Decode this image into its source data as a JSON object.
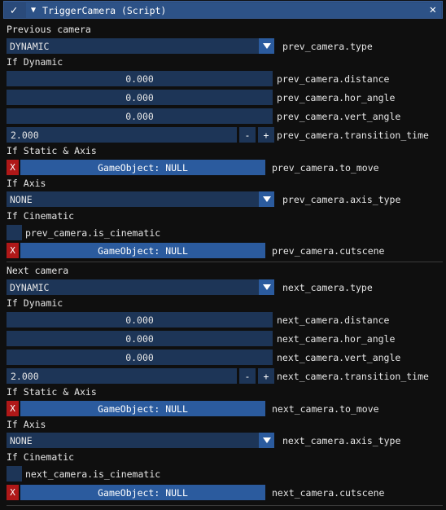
{
  "component": {
    "title": "TriggerCamera (Script)",
    "enabled_icon": "check-icon",
    "collapse_icon": "triangle-down-icon",
    "close_icon": "close-icon"
  },
  "prev": {
    "section_title": "Previous camera",
    "type_value": "DYNAMIC",
    "type_label": "prev_camera.type",
    "if_dynamic": "If Dynamic",
    "distance_value": "0.000",
    "distance_label": "prev_camera.distance",
    "hor_angle_value": "0.000",
    "hor_angle_label": "prev_camera.hor_angle",
    "vert_angle_value": "0.000",
    "vert_angle_label": "prev_camera.vert_angle",
    "transition_value": "2.000",
    "transition_label": "prev_camera.transition_time",
    "minus": "-",
    "plus": "+",
    "if_static_axis": "If Static & Axis",
    "to_move_value": "GameObject: NULL",
    "to_move_label": "prev_camera.to_move",
    "if_axis": "If Axis",
    "axis_type_value": "NONE",
    "axis_type_label": "prev_camera.axis_type",
    "if_cinematic": "If Cinematic",
    "is_cinematic_label": "prev_camera.is_cinematic",
    "cutscene_value": "GameObject: NULL",
    "cutscene_label": "prev_camera.cutscene",
    "x": "X"
  },
  "next": {
    "section_title": "Next camera",
    "type_value": "DYNAMIC",
    "type_label": "next_camera.type",
    "if_dynamic": "If Dynamic",
    "distance_value": "0.000",
    "distance_label": "next_camera.distance",
    "hor_angle_value": "0.000",
    "hor_angle_label": "next_camera.hor_angle",
    "vert_angle_value": "0.000",
    "vert_angle_label": "next_camera.vert_angle",
    "transition_value": "2.000",
    "transition_label": "next_camera.transition_time",
    "minus": "-",
    "plus": "+",
    "if_static_axis": "If Static & Axis",
    "to_move_value": "GameObject: NULL",
    "to_move_label": "next_camera.to_move",
    "if_axis": "If Axis",
    "axis_type_value": "NONE",
    "axis_type_label": "next_camera.axis_type",
    "if_cinematic": "If Cinematic",
    "is_cinematic_label": "next_camera.is_cinematic",
    "cutscene_value": "GameObject: NULL",
    "cutscene_label": "next_camera.cutscene",
    "x": "X"
  },
  "colors": {
    "header_bg": "#2d5287",
    "field_bg": "#1d3557",
    "button_bg": "#2b5b9e",
    "remove_red": "#b01818",
    "panel_bg": "#0f0f0f"
  }
}
